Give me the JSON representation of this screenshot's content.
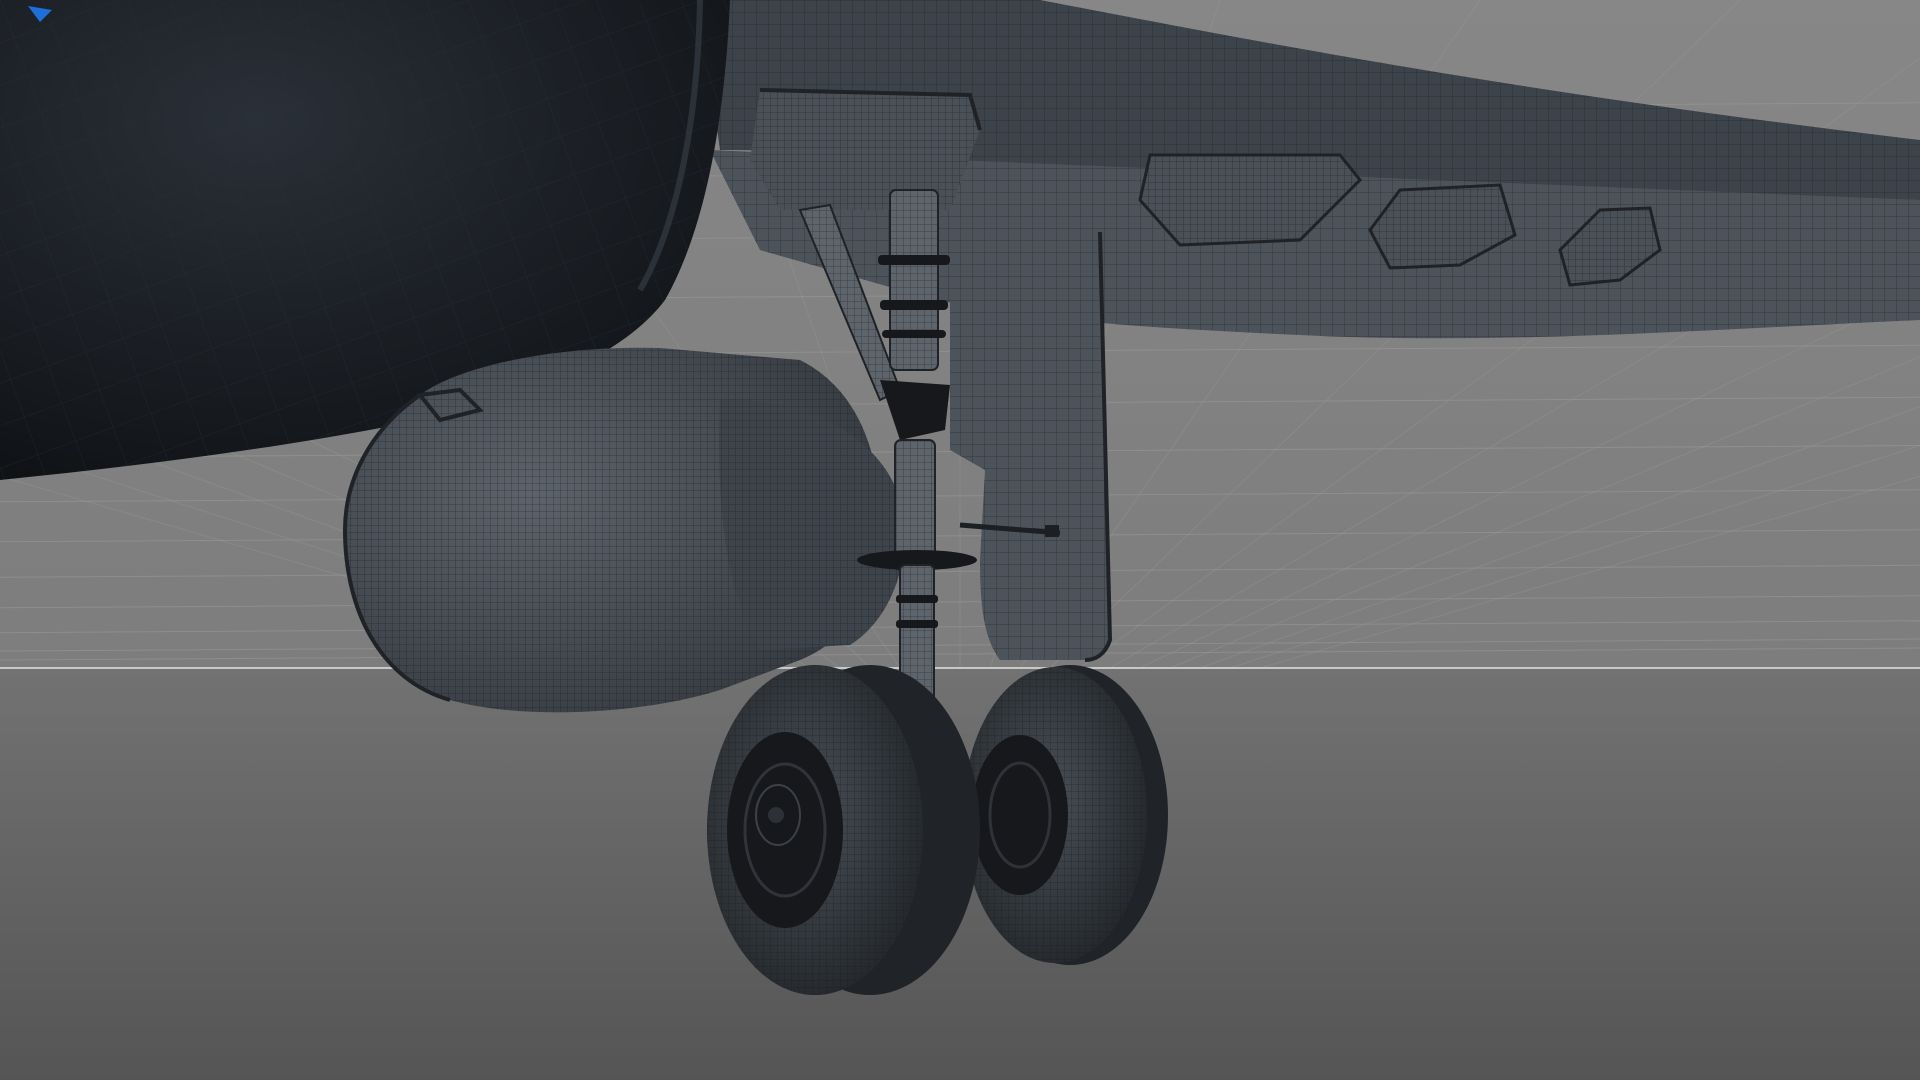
{
  "viewport": {
    "view_label": "",
    "colors": {
      "sky_top": "#878787",
      "sky_bottom": "#7d7d7d",
      "ground_top": "#727272",
      "ground_bottom": "#555555",
      "horizon_line": "#c8c8c8",
      "grid_line": "#9a9a9a",
      "fuselage_dark": "#15181c",
      "fuselage_mid": "#262b31",
      "wing": "#3d434a",
      "wing_light": "#4d535a",
      "nacelle": "#4a5058",
      "strut": "#5d646b",
      "tire": "#3a3f45",
      "hub": "#16181b",
      "wire": "#1f2226",
      "accent": "#1e6fd9"
    },
    "icons": [
      "orientation-marker-icon"
    ]
  }
}
